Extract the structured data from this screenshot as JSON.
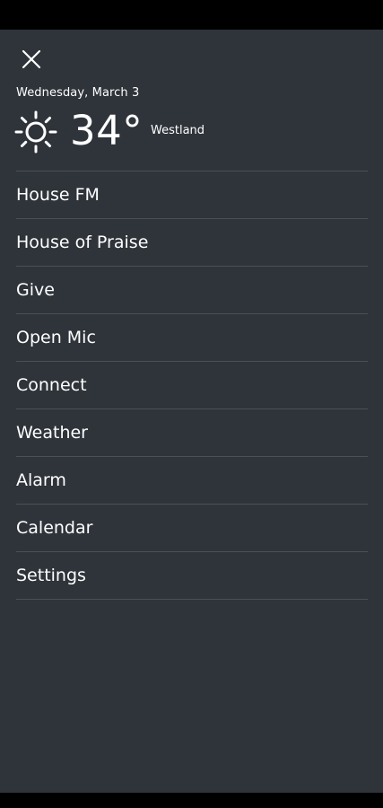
{
  "header": {
    "date": "Wednesday, March 3",
    "temperature": "34°",
    "location": "Westland",
    "weather_icon": "sun-icon",
    "close_icon": "close-icon"
  },
  "menu": {
    "items": [
      {
        "label": "House FM"
      },
      {
        "label": "House of Praise"
      },
      {
        "label": "Give"
      },
      {
        "label": "Open Mic"
      },
      {
        "label": "Connect"
      },
      {
        "label": "Weather"
      },
      {
        "label": "Alarm"
      },
      {
        "label": "Calendar"
      },
      {
        "label": "Settings"
      }
    ]
  },
  "colors": {
    "panel_background": "#2f343b",
    "divider": "#4a5058",
    "text": "#ffffff"
  }
}
